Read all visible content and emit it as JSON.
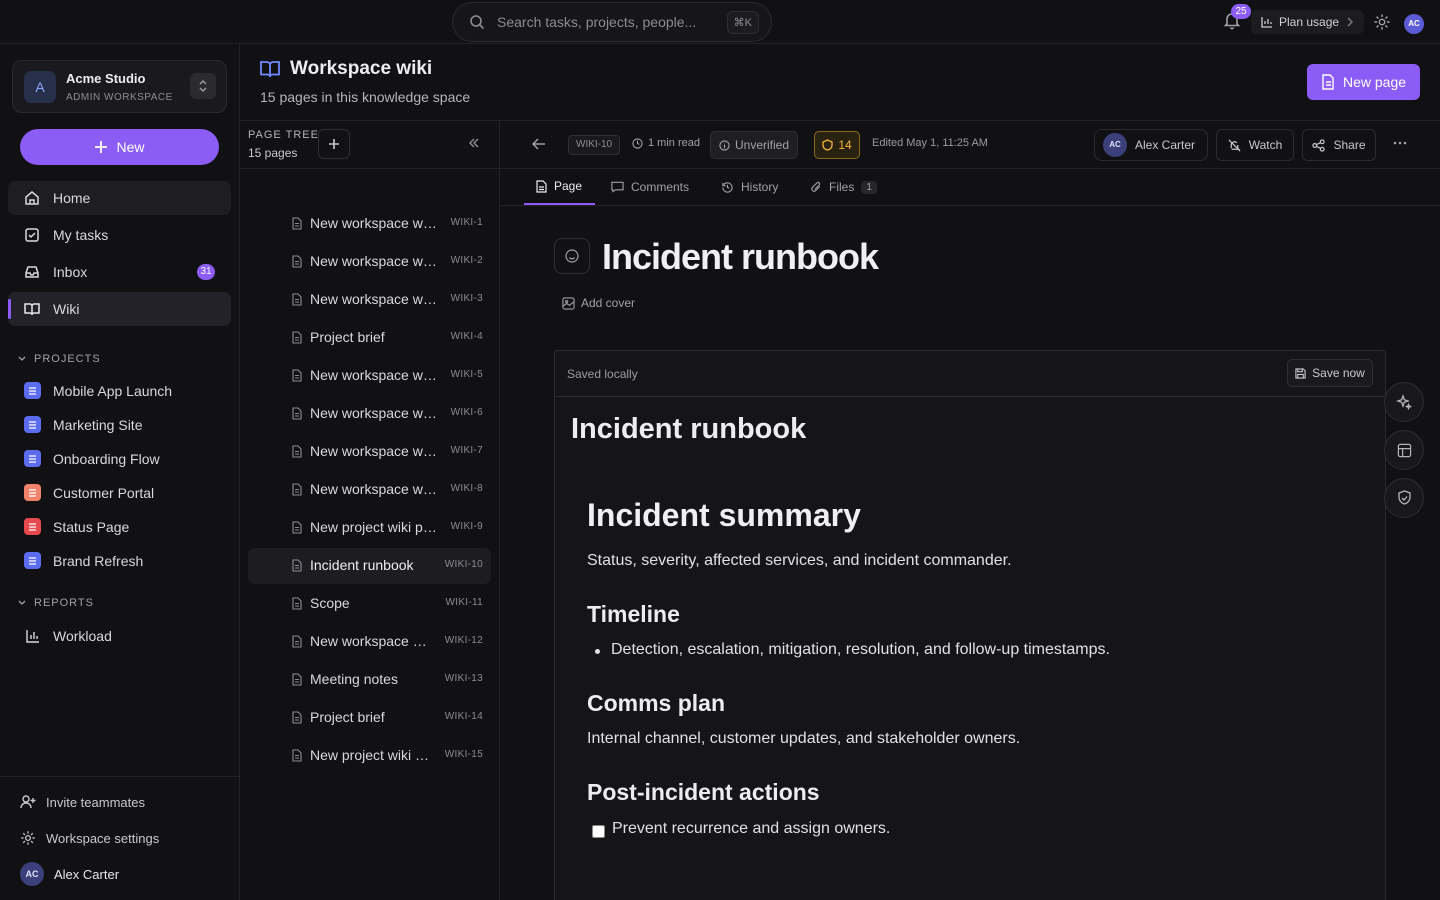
{
  "topbar": {
    "search_placeholder": "Search tasks, projects, people...",
    "search_shortcut": "⌘K",
    "notifications_count": "25",
    "plan_usage_label": "Plan usage",
    "user_initials": "AC"
  },
  "sidebar": {
    "workspace_name": "Acme Studio",
    "workspace_role": "ADMIN WORKSPACE",
    "workspace_initial": "A",
    "new_label": "New",
    "nav": [
      {
        "label": "Home"
      },
      {
        "label": "My tasks"
      },
      {
        "label": "Inbox",
        "count": "31"
      },
      {
        "label": "Wiki"
      }
    ],
    "projects_label": "PROJECTS",
    "projects": [
      {
        "label": "Mobile App Launch",
        "color": "#5b6cf0"
      },
      {
        "label": "Marketing Site",
        "color": "#5b6cf0"
      },
      {
        "label": "Onboarding Flow",
        "color": "#5b6cf0"
      },
      {
        "label": "Customer Portal",
        "color": "#f0826a"
      },
      {
        "label": "Status Page",
        "color": "#e5484d"
      },
      {
        "label": "Brand Refresh",
        "color": "#5b6cf0"
      }
    ],
    "reports_label": "REPORTS",
    "reports": [
      {
        "label": "Workload"
      }
    ],
    "footer": {
      "invite": "Invite teammates",
      "settings": "Workspace settings",
      "user_name": "Alex Carter",
      "user_initials": "AC"
    }
  },
  "header": {
    "title": "Workspace wiki",
    "subtitle": "15 pages in this knowledge space",
    "new_page_label": "New page"
  },
  "tree": {
    "title": "PAGE TREE",
    "count": "15 pages",
    "pages": [
      {
        "label": "New workspace wiki page",
        "id": "WIKI-1"
      },
      {
        "label": "New workspace wiki page",
        "id": "WIKI-2"
      },
      {
        "label": "New workspace wiki page",
        "id": "WIKI-3"
      },
      {
        "label": "Project brief",
        "id": "WIKI-4"
      },
      {
        "label": "New workspace wiki page",
        "id": "WIKI-5"
      },
      {
        "label": "New workspace wiki page",
        "id": "WIKI-6"
      },
      {
        "label": "New workspace wiki page",
        "id": "WIKI-7"
      },
      {
        "label": "New workspace wiki page",
        "id": "WIKI-8"
      },
      {
        "label": "New project wiki page",
        "id": "WIKI-9"
      },
      {
        "label": "Incident runbook",
        "id": "WIKI-10"
      },
      {
        "label": "Scope",
        "id": "WIKI-11"
      },
      {
        "label": "New workspace wiki page",
        "id": "WIKI-12"
      },
      {
        "label": "Meeting notes",
        "id": "WIKI-13"
      },
      {
        "label": "Project brief",
        "id": "WIKI-14"
      },
      {
        "label": "New project wiki page",
        "id": "WIKI-15"
      }
    ]
  },
  "doc_bar": {
    "page_id": "WIKI-10",
    "read_time": "1 min read",
    "verification": "Unverified",
    "score": "14",
    "edited": "Edited May 1, 11:25 AM",
    "owner_name": "Alex Carter",
    "owner_initials": "AC",
    "watch_label": "Watch",
    "share_label": "Share"
  },
  "tabs": [
    {
      "label": "Page"
    },
    {
      "label": "Comments"
    },
    {
      "label": "History"
    },
    {
      "label": "Files",
      "count": "1"
    }
  ],
  "document": {
    "title": "Incident runbook",
    "add_cover": "Add cover",
    "saved_status": "Saved locally",
    "save_now": "Save now",
    "body_title": "Incident runbook",
    "h1": "Incident summary",
    "p1": "Status, severity, affected services, and incident commander.",
    "h2_timeline": "Timeline",
    "li_timeline": "Detection, escalation, mitigation, resolution, and follow-up timestamps.",
    "h2_comms": "Comms plan",
    "p_comms": "Internal channel, customer updates, and stakeholder owners.",
    "h2_post": "Post-incident actions",
    "task": "Prevent recurrence and assign owners."
  },
  "colors": {
    "accent": "#8b5cf6",
    "warning": "#f5b73b"
  }
}
